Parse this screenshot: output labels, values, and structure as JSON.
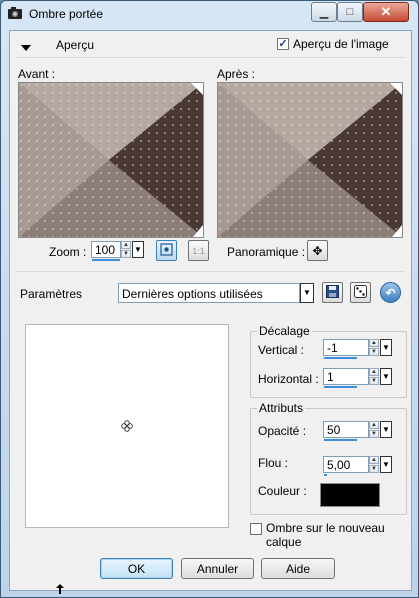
{
  "window": {
    "title": "Ombre portée",
    "minimize_icon": "minimize-icon",
    "maximize_icon": "maximize-icon",
    "close_icon": "close-icon"
  },
  "preview_section": {
    "label": "Aperçu",
    "image_preview_label": "Aperçu de l'image",
    "image_preview_checked": true,
    "before_label": "Avant :",
    "after_label": "Après :",
    "zoom_label": "Zoom :",
    "zoom_value": "100",
    "pan_label": "Panoramique :"
  },
  "params": {
    "label": "Paramètres",
    "preset_value": "Dernières options utilisées"
  },
  "offset": {
    "group_label": "Décalage",
    "vertical_label": "Vertical :",
    "vertical_value": "-1",
    "horizontal_label": "Horizontal :",
    "horizontal_value": "1"
  },
  "attributes": {
    "group_label": "Attributs",
    "opacity_label": "Opacité :",
    "opacity_value": "50",
    "blur_label": "Flou :",
    "blur_value": "5,00",
    "color_label": "Couleur :",
    "color_swatch": "#000000"
  },
  "new_layer": {
    "label": "Ombre sur le nouveau calque",
    "checked": false
  },
  "buttons": {
    "ok": "OK",
    "cancel": "Annuler",
    "help": "Aide"
  },
  "colors": {
    "accent": "#3c8ddb",
    "titlebar": "#c9dcef"
  }
}
